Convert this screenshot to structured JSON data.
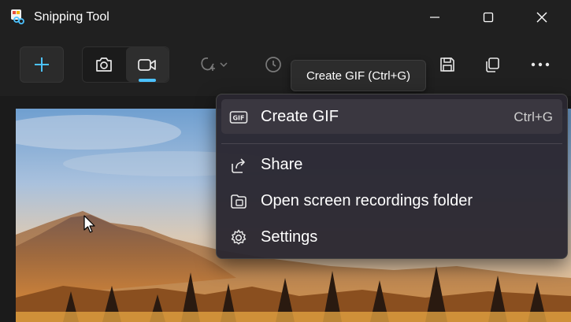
{
  "window": {
    "title": "Snipping Tool"
  },
  "toolbar": {
    "new_button_icon": "plus-icon",
    "modes": [
      "camera-icon",
      "video-camera-icon"
    ],
    "active_mode": "video",
    "shape_icon": "shape-icon",
    "timer_icon": "clock-icon",
    "save_icon": "save-icon",
    "copy_icon": "copy-icon",
    "more_icon": "more-icon"
  },
  "tooltip": {
    "text": "Create GIF (Ctrl+G)"
  },
  "menu": {
    "items": [
      {
        "label": "Create GIF",
        "shortcut": "Ctrl+G",
        "icon": "gif-icon"
      },
      {
        "label": "Share",
        "icon": "share-icon"
      },
      {
        "label": "Open screen recordings folder",
        "icon": "folder-icon"
      },
      {
        "label": "Settings",
        "icon": "gear-icon"
      }
    ]
  },
  "colors": {
    "accent": "#4cc2ff",
    "background": "#202020",
    "menu_background": "#2a2630"
  }
}
